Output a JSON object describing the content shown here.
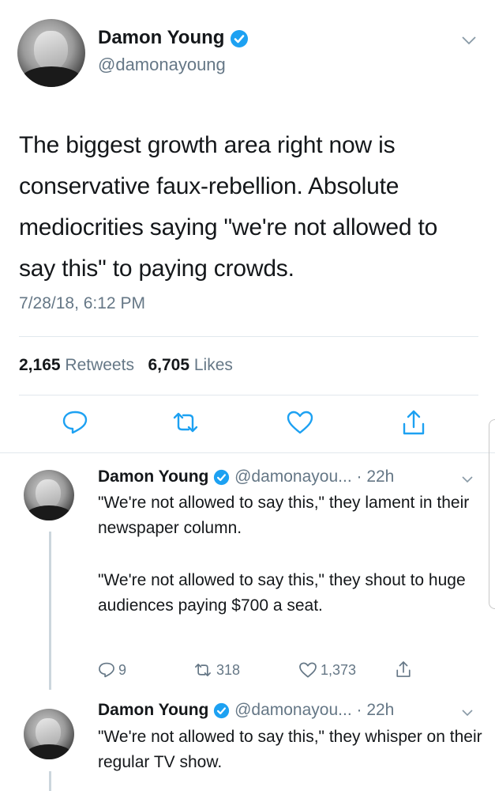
{
  "main_tweet": {
    "author_name": "Damon Young",
    "handle": "@damonayoung",
    "text": "The biggest growth area right now is conservative faux-rebellion. Absolute mediocrities saying \"we're not allowed to say this\" to paying crowds.",
    "timestamp": "7/28/18, 6:12 PM",
    "retweet_count": "2,165",
    "retweet_label": "Retweets",
    "like_count": "6,705",
    "like_label": "Likes"
  },
  "replies": [
    {
      "author_name": "Damon Young",
      "handle": "@damonayou...",
      "time": "· 22h",
      "text_p1": "\"We're not allowed to say this,\" they lament in their newspaper column.",
      "text_p2": "\"We're not allowed to say this,\" they shout to huge audiences paying  $700 a seat.",
      "reply_count": "9",
      "retweet_count": "318",
      "like_count": "1,373"
    },
    {
      "author_name": "Damon Young",
      "handle": "@damonayou...",
      "time": "· 22h",
      "text_p1": "\"We're not allowed to say this,\" they whisper on their regular TV show."
    }
  ],
  "icons": {
    "verified": "verified-badge-icon",
    "chevron": "chevron-down-icon",
    "reply": "reply-bubble-icon",
    "retweet": "retweet-icon",
    "like": "heart-icon",
    "share": "share-icon"
  },
  "colors": {
    "verified": "#1da1f2",
    "text": "#14171a",
    "muted": "#657786",
    "divider": "#e1e8ed"
  }
}
